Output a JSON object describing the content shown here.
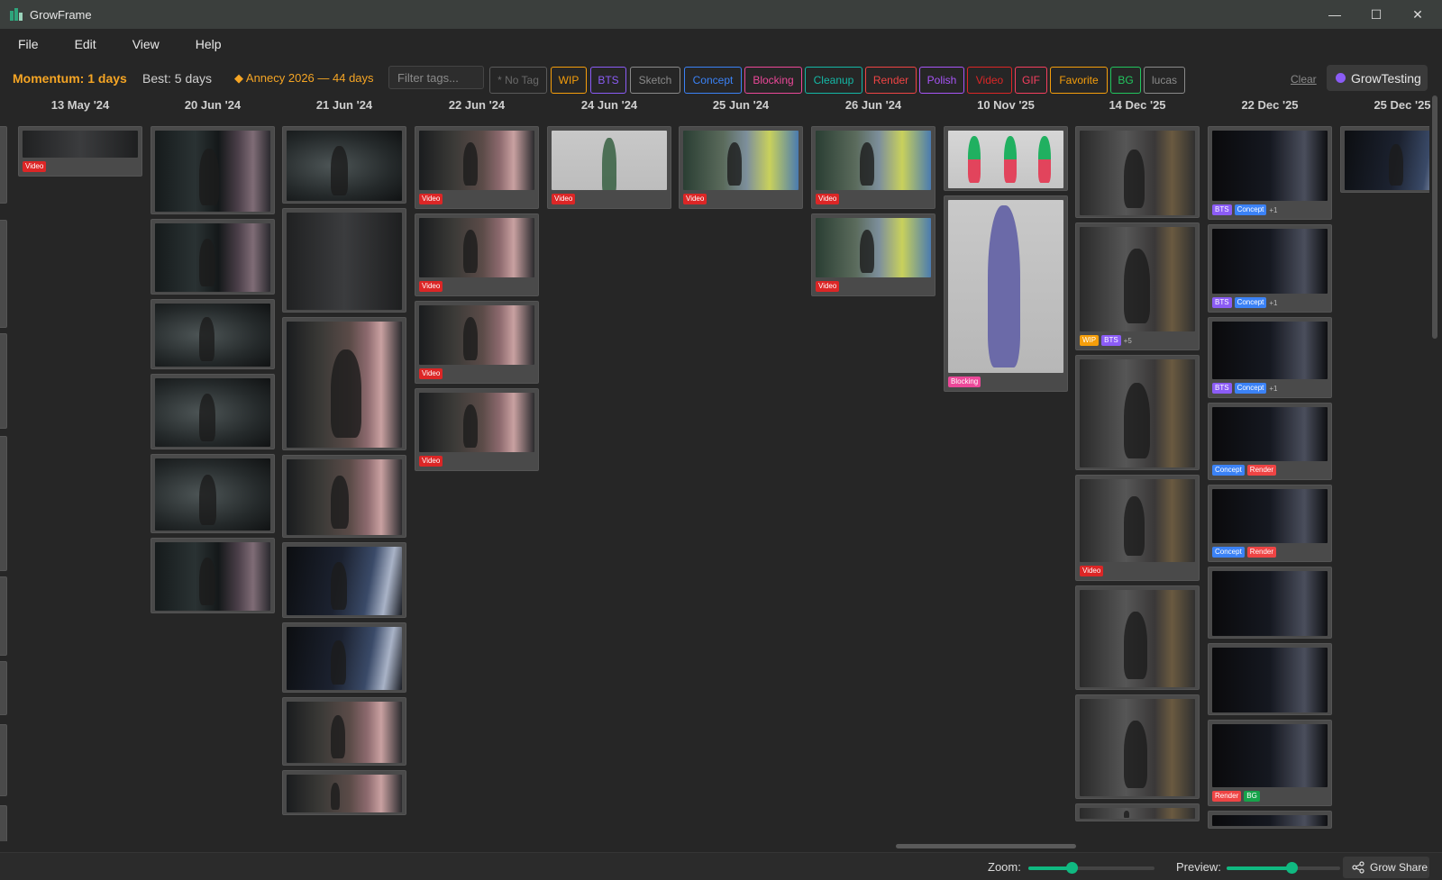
{
  "app": {
    "title": "GrowFrame"
  },
  "window_controls": {
    "minimize": "—",
    "maximize": "☐",
    "close": "✕"
  },
  "menu": [
    "File",
    "Edit",
    "View",
    "Help"
  ],
  "toolbar": {
    "momentum": "Momentum: 1 days",
    "best": "Best: 5 days",
    "event": "◆ Annecy 2026 — 44 days",
    "filter_placeholder": "Filter tags...",
    "clear": "Clear",
    "user": "GrowTesting"
  },
  "tag_filters": [
    {
      "label": "* No Tag",
      "color": "#5a5a5a"
    },
    {
      "label": "WIP",
      "color": "#f59e0b"
    },
    {
      "label": "BTS",
      "color": "#8b5cf6"
    },
    {
      "label": "Sketch",
      "color": "#8a8a8a"
    },
    {
      "label": "Concept",
      "color": "#3b82f6"
    },
    {
      "label": "Blocking",
      "color": "#ec4899"
    },
    {
      "label": "Cleanup",
      "color": "#14b8a6"
    },
    {
      "label": "Render",
      "color": "#ef4444"
    },
    {
      "label": "Polish",
      "color": "#a855f7"
    },
    {
      "label": "Video",
      "color": "#dc2626"
    },
    {
      "label": "GIF",
      "color": "#f43f5e"
    },
    {
      "label": "Favorite",
      "color": "#f59e0b"
    },
    {
      "label": "BG",
      "color": "#22c55e"
    },
    {
      "label": "lucas",
      "color": "#8a8a8a"
    }
  ],
  "tag_colors": {
    "Video": "#dc2626",
    "BTS": "#8b5cf6",
    "Concept": "#3b82f6",
    "WIP": "#f59e0b",
    "Blocking": "#ec4899",
    "Render": "#ef4444",
    "BG": "#16a34a"
  },
  "dates": [
    "13 May '24",
    "20 Jun '24",
    "21 Jun '24",
    "22 Jun '24",
    "24 Jun '24",
    "25 Jun '24",
    "26 Jun '24",
    "10 Nov '25",
    "14 Dec '25",
    "22 Dec '25",
    "25 Dec '25"
  ],
  "columns": [
    [
      {
        "h": 56,
        "t": "e",
        "tags": [
          "Video"
        ]
      }
    ],
    [
      {
        "h": 98,
        "t": "b"
      },
      {
        "h": 84,
        "t": "b"
      },
      {
        "h": 78,
        "t": "a"
      },
      {
        "h": 84,
        "t": "a"
      },
      {
        "h": 88,
        "t": "a"
      },
      {
        "h": 84,
        "t": "b"
      }
    ],
    [
      {
        "h": 86,
        "t": "a"
      },
      {
        "h": 116,
        "t": "e"
      },
      {
        "h": 148,
        "t": "c"
      },
      {
        "h": 92,
        "t": "c"
      },
      {
        "h": 84,
        "t": "d"
      },
      {
        "h": 78,
        "t": "d"
      },
      {
        "h": 76,
        "t": "c"
      },
      {
        "h": 50,
        "t": "c"
      }
    ],
    [
      {
        "h": 92,
        "t": "c",
        "tags": [
          "Video"
        ]
      },
      {
        "h": 92,
        "t": "c",
        "tags": [
          "Video"
        ]
      },
      {
        "h": 92,
        "t": "c",
        "tags": [
          "Video"
        ]
      },
      {
        "h": 92,
        "t": "c",
        "tags": [
          "Video"
        ]
      }
    ],
    [
      {
        "h": 92,
        "t": "f",
        "tags": [
          "Video"
        ]
      }
    ],
    [
      {
        "h": 92,
        "t": "g",
        "tags": [
          "Video"
        ]
      }
    ],
    [
      {
        "h": 92,
        "t": "g",
        "tags": [
          "Video"
        ]
      },
      {
        "h": 92,
        "t": "g",
        "tags": [
          "Video"
        ]
      }
    ],
    [
      {
        "h": 72,
        "t": "h"
      },
      {
        "h": 218,
        "t": "i",
        "tags": [
          "Blocking"
        ]
      }
    ],
    [
      {
        "h": 102,
        "t": "j"
      },
      {
        "h": 142,
        "t": "j",
        "tags": [
          "WIP",
          "BTS"
        ],
        "more": "+5"
      },
      {
        "h": 128,
        "t": "j"
      },
      {
        "h": 118,
        "t": "j",
        "tags": [
          "Video"
        ]
      },
      {
        "h": 116,
        "t": "j"
      },
      {
        "h": 116,
        "t": "j"
      },
      {
        "h": 20,
        "t": "j"
      }
    ],
    [
      {
        "h": 104,
        "t": "k",
        "tags": [
          "BTS",
          "Concept"
        ],
        "more": "+1"
      },
      {
        "h": 98,
        "t": "k",
        "tags": [
          "BTS",
          "Concept"
        ],
        "more": "+1"
      },
      {
        "h": 90,
        "t": "k",
        "tags": [
          "BTS",
          "Concept"
        ],
        "more": "+1"
      },
      {
        "h": 86,
        "t": "k",
        "tags": [
          "Concept",
          "Render"
        ]
      },
      {
        "h": 86,
        "t": "k",
        "tags": [
          "Concept",
          "Render"
        ]
      },
      {
        "h": 80,
        "t": "k"
      },
      {
        "h": 80,
        "t": "k"
      },
      {
        "h": 96,
        "t": "k",
        "tags": [
          "Render",
          "BG"
        ]
      },
      {
        "h": 20,
        "t": "k"
      }
    ],
    [
      {
        "h": 74,
        "t": "d"
      }
    ]
  ],
  "statusbar": {
    "zoom_label": "Zoom:",
    "zoom_value": 0.34,
    "preview_label": "Preview:",
    "preview_value": 0.57,
    "share": "Grow Share"
  }
}
